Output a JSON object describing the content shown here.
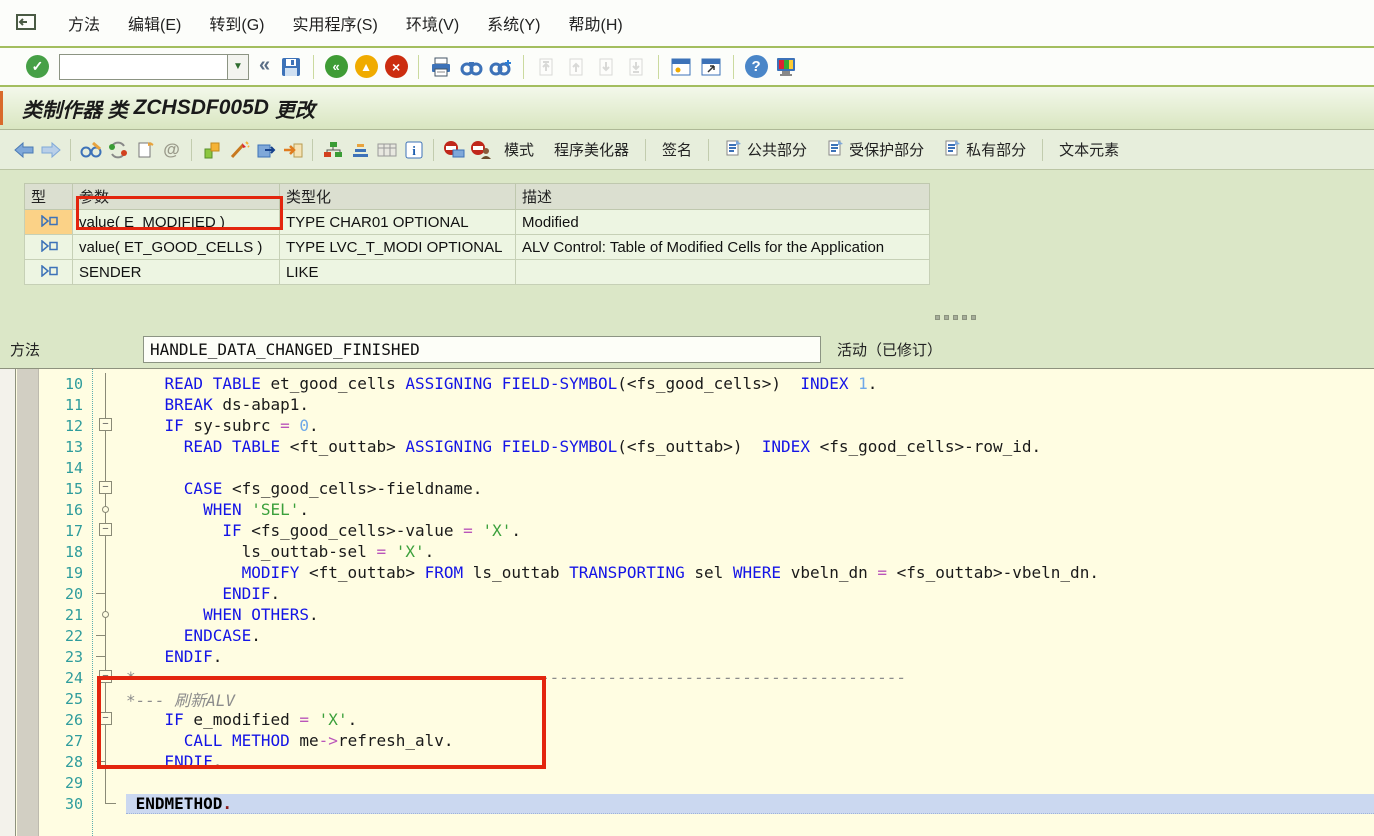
{
  "menu": {
    "items": [
      "方法",
      "编辑(E)",
      "转到(G)",
      "实用程序(S)",
      "环境(V)",
      "系统(Y)",
      "帮助(H)"
    ]
  },
  "standard_toolbar": {
    "command_value": "",
    "collapse_glyph": "«",
    "groups": [
      [
        "save-icon"
      ],
      [
        "back-icon",
        "exit-icon",
        "cancel-icon"
      ],
      [
        "print-icon",
        "find-icon",
        "find-next-icon"
      ],
      [
        "first-page-icon",
        "previous-page-icon",
        "next-page-icon",
        "last-page-icon"
      ],
      [
        "new-session-icon",
        "shortcut-icon"
      ],
      [
        "help-icon",
        "customize-icon"
      ]
    ]
  },
  "title_bar": {
    "prefix": "类制作器 类",
    "class_name": "ZCHSDF005D",
    "suffix": "更改"
  },
  "app_toolbar": {
    "icon_groups": [
      [
        "back-nav-icon",
        "forward-nav-icon"
      ],
      [
        "display-change-icon",
        "refresh-icon",
        "copy-icon",
        "trace-icon"
      ],
      [
        "syntax-check-icon",
        "pretty-printer-icon",
        "navigate-icon",
        "where-used-icon"
      ],
      [
        "hierarchy-icon",
        "sort-icon",
        "table-view-icon",
        "info-icon"
      ],
      [
        "stop-watchpoint-icon",
        "stop-user-icon"
      ]
    ],
    "text_buttons": [
      "模式",
      "程序美化器"
    ],
    "signature_button": "签名",
    "section_buttons": [
      "公共部分",
      "受保护部分",
      "私有部分"
    ],
    "text_elements_button": "文本元素"
  },
  "params_table": {
    "headers": [
      "型",
      "参数",
      "类型化",
      "描述"
    ],
    "type_icon": "exporting-parameter-icon",
    "rows": [
      {
        "param": "value( E_MODIFIED )",
        "typing": "TYPE CHAR01 OPTIONAL",
        "desc": "Modified",
        "selected": true
      },
      {
        "param": "value( ET_GOOD_CELLS )",
        "typing": "TYPE LVC_T_MODI OPTIONAL",
        "desc": "ALV Control: Table of Modified Cells for the Application",
        "selected": false
      },
      {
        "param": "SENDER",
        "typing": "LIKE",
        "desc": "",
        "selected": false
      }
    ]
  },
  "method_row": {
    "label": "方法",
    "value": "HANDLE_DATA_CHANGED_FINISHED",
    "status": "活动（已修订）"
  },
  "editor": {
    "lines": [
      {
        "n": 10,
        "indent": 4,
        "fold": null,
        "seg": [
          [
            "kw",
            "READ TABLE"
          ],
          [
            "id",
            " et_good_cells "
          ],
          [
            "kw",
            "ASSIGNING FIELD-SYMBOL"
          ],
          [
            "id",
            "(<fs_good_cells>)  "
          ],
          [
            "kw",
            "INDEX"
          ],
          [
            "id",
            " "
          ],
          [
            "num",
            "1"
          ],
          [
            "id",
            "."
          ]
        ]
      },
      {
        "n": 11,
        "indent": 4,
        "fold": null,
        "seg": [
          [
            "kw",
            "BREAK"
          ],
          [
            "id",
            " ds-abap1."
          ]
        ]
      },
      {
        "n": 12,
        "indent": 4,
        "fold": "minus",
        "seg": [
          [
            "kw",
            "IF"
          ],
          [
            "id",
            " sy-subrc "
          ],
          [
            "op",
            "="
          ],
          [
            "id",
            " "
          ],
          [
            "num",
            "0"
          ],
          [
            "id",
            "."
          ]
        ]
      },
      {
        "n": 13,
        "indent": 6,
        "fold": null,
        "seg": [
          [
            "kw",
            "READ TABLE"
          ],
          [
            "id",
            " <ft_outtab> "
          ],
          [
            "kw",
            "ASSIGNING FIELD-SYMBOL"
          ],
          [
            "id",
            "(<fs_outtab>)  "
          ],
          [
            "kw",
            "INDEX"
          ],
          [
            "id",
            " <fs_good_cells>-row_id."
          ]
        ]
      },
      {
        "n": 14,
        "indent": 0,
        "fold": null,
        "seg": []
      },
      {
        "n": 15,
        "indent": 6,
        "fold": "minus",
        "seg": [
          [
            "kw",
            "CASE"
          ],
          [
            "id",
            " <fs_good_cells>-fieldname."
          ]
        ]
      },
      {
        "n": 16,
        "indent": 8,
        "fold": "circle",
        "seg": [
          [
            "kw",
            "WHEN"
          ],
          [
            "id",
            " "
          ],
          [
            "str",
            "'SEL'"
          ],
          [
            "id",
            "."
          ]
        ]
      },
      {
        "n": 17,
        "indent": 10,
        "fold": "minus",
        "seg": [
          [
            "kw",
            "IF"
          ],
          [
            "id",
            " <fs_good_cells>-value "
          ],
          [
            "op",
            "="
          ],
          [
            "id",
            " "
          ],
          [
            "str",
            "'X'"
          ],
          [
            "id",
            "."
          ]
        ]
      },
      {
        "n": 18,
        "indent": 12,
        "fold": null,
        "seg": [
          [
            "id",
            "ls_outtab-sel "
          ],
          [
            "op",
            "="
          ],
          [
            "id",
            " "
          ],
          [
            "str",
            "'X'"
          ],
          [
            "id",
            "."
          ]
        ]
      },
      {
        "n": 19,
        "indent": 12,
        "fold": null,
        "seg": [
          [
            "kw",
            "MODIFY"
          ],
          [
            "id",
            " <ft_outtab> "
          ],
          [
            "kw",
            "FROM"
          ],
          [
            "id",
            " ls_outtab "
          ],
          [
            "kw",
            "TRANSPORTING"
          ],
          [
            "id",
            " sel "
          ],
          [
            "kw",
            "WHERE"
          ],
          [
            "id",
            " vbeln_dn "
          ],
          [
            "op",
            "="
          ],
          [
            "id",
            " <fs_outtab>-vbeln_dn."
          ]
        ]
      },
      {
        "n": 20,
        "indent": 10,
        "fold": "tick",
        "seg": [
          [
            "kw",
            "ENDIF"
          ],
          [
            "id",
            "."
          ]
        ]
      },
      {
        "n": 21,
        "indent": 8,
        "fold": "circle",
        "seg": [
          [
            "kw",
            "WHEN OTHERS"
          ],
          [
            "id",
            "."
          ]
        ]
      },
      {
        "n": 22,
        "indent": 6,
        "fold": "tick",
        "seg": [
          [
            "kw",
            "ENDCASE"
          ],
          [
            "id",
            "."
          ]
        ]
      },
      {
        "n": 23,
        "indent": 4,
        "fold": "tick",
        "seg": [
          [
            "kw",
            "ENDIF"
          ],
          [
            "id",
            "."
          ]
        ]
      },
      {
        "n": 24,
        "indent": 0,
        "fold": "minus",
        "seg": [
          [
            "cmt",
            "*--------------------------------------------------------------------------------"
          ]
        ]
      },
      {
        "n": 25,
        "indent": 0,
        "fold": null,
        "seg": [
          [
            "cmt",
            "*--- 刷新ALV"
          ]
        ]
      },
      {
        "n": 26,
        "indent": 4,
        "fold": "minus",
        "seg": [
          [
            "kw",
            "IF"
          ],
          [
            "id",
            " e_modified "
          ],
          [
            "op",
            "="
          ],
          [
            "id",
            " "
          ],
          [
            "str",
            "'X'"
          ],
          [
            "id",
            "."
          ]
        ]
      },
      {
        "n": 27,
        "indent": 6,
        "fold": null,
        "seg": [
          [
            "kw",
            "CALL METHOD"
          ],
          [
            "id",
            " me"
          ],
          [
            "op",
            "->"
          ],
          [
            "id",
            "refresh_alv."
          ]
        ]
      },
      {
        "n": 28,
        "indent": 4,
        "fold": "tick",
        "seg": [
          [
            "kw",
            "ENDIF"
          ],
          [
            "id",
            "."
          ]
        ]
      },
      {
        "n": 29,
        "indent": 0,
        "fold": null,
        "seg": []
      },
      {
        "n": 30,
        "indent": 1,
        "fold": "end",
        "hl": true,
        "seg": [
          [
            "kwb",
            "ENDMETHOD"
          ],
          [
            "dot",
            "."
          ]
        ]
      }
    ]
  },
  "annotations": {
    "colors": {
      "highlight_red": "#E3250E"
    }
  }
}
